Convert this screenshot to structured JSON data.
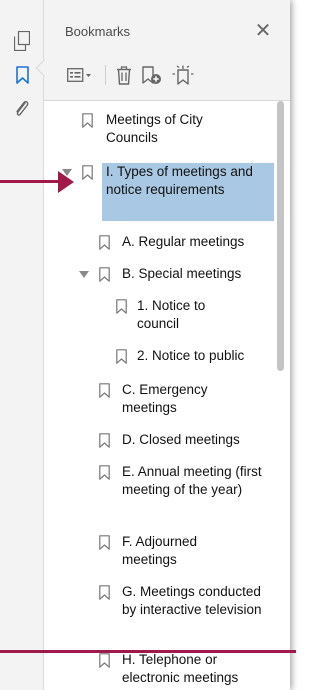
{
  "panel": {
    "title": "Bookmarks",
    "close_symbol": "✕"
  },
  "rail": {
    "items": [
      {
        "name": "pages-icon"
      },
      {
        "name": "bookmark-icon",
        "active": true
      },
      {
        "name": "paperclip-icon"
      }
    ]
  },
  "toolbar": {
    "items": [
      "options-menu-icon",
      "delete-bookmark-icon",
      "new-bookmark-icon",
      "expand-bookmark-icon"
    ]
  },
  "bookmarks": {
    "items": [
      {
        "label": "Meetings of City Councils"
      },
      {
        "label": "I. Types of meetings and notice requirements",
        "selected": true,
        "expanded": true
      },
      {
        "label": "A. Regular meetings"
      },
      {
        "label": "B. Special meetings",
        "expanded": true
      },
      {
        "label": "1. Notice to council"
      },
      {
        "label": "2. Notice to public"
      },
      {
        "label": "C. Emergency meetings"
      },
      {
        "label": "D. Closed meetings"
      },
      {
        "label": "E. Annual meeting (first meeting of the year)"
      },
      {
        "label": "F. Adjourned meetings"
      },
      {
        "label": "G. Meetings conducted by interactive television"
      },
      {
        "label": "H. Telephone or electronic meetings"
      }
    ]
  },
  "colors": {
    "accent": "#1a73d9",
    "selection": "#a9c8e3",
    "annotation": "#a0194a"
  }
}
